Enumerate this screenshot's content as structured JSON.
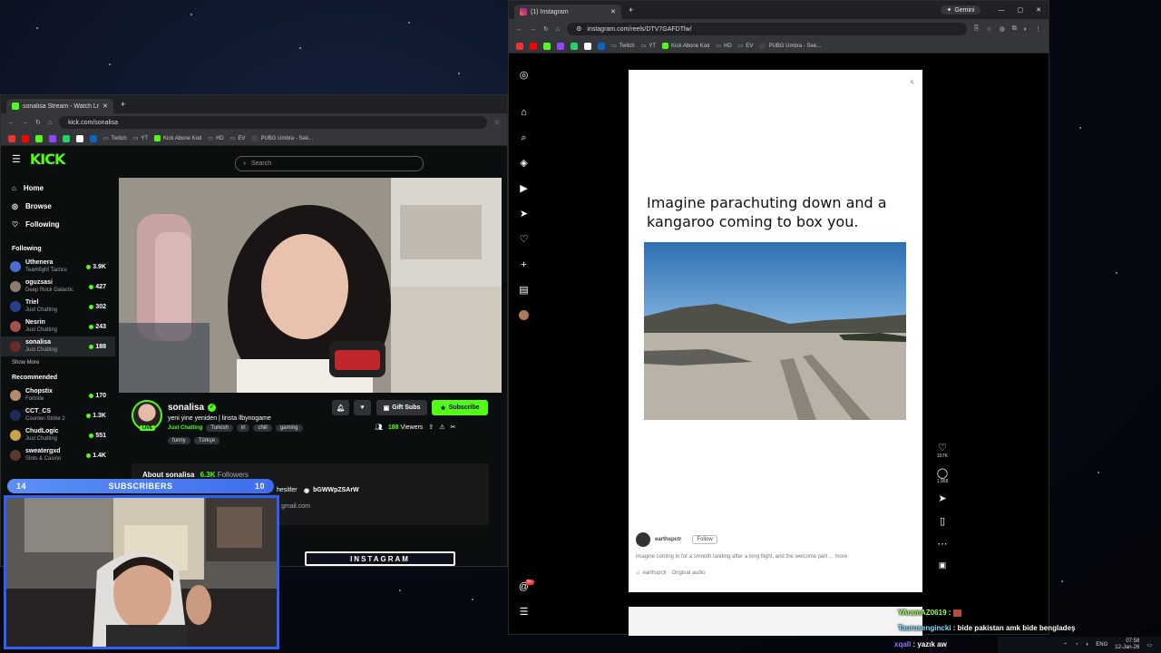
{
  "kick_browser": {
    "tab_title": "sonalisa Stream - Watch Live o",
    "url": "kick.com/sonalisa",
    "bookmarks": [
      "Twitch",
      "YT",
      "Kick Abone Kod",
      "HD",
      "EV",
      "PUBG Umbra - Seé..."
    ],
    "search_placeholder": "Search",
    "nav": [
      "Home",
      "Browse",
      "Following"
    ],
    "following_header": "Following",
    "following": [
      {
        "name": "Uthenera",
        "category": "Teamfight Tactics",
        "viewers": "3.9K"
      },
      {
        "name": "oguzsasi",
        "category": "Deep Rock Galactic",
        "viewers": "427"
      },
      {
        "name": "Triel",
        "category": "Just Chatting",
        "viewers": "302"
      },
      {
        "name": "Nesrin",
        "category": "Just Chatting",
        "viewers": "243"
      },
      {
        "name": "sonalisa",
        "category": "Just Chatting",
        "viewers": "188"
      }
    ],
    "show_more": "Show More",
    "recommended_header": "Recommended",
    "recommended": [
      {
        "name": "Chopstix",
        "category": "Fortnite",
        "viewers": "170"
      },
      {
        "name": "CCT_CS",
        "category": "Counter-Strike 2",
        "viewers": "1.3K"
      },
      {
        "name": "ChudLogic",
        "category": "Just Chatting",
        "viewers": "551"
      },
      {
        "name": "sweatergxd",
        "category": "Slots & Casino",
        "viewers": "1.4K"
      }
    ],
    "streamer": {
      "name": "sonalisa",
      "title": "yeni yine yeniden | linsta llbynogame",
      "category": "Just Chatting",
      "tags": [
        "Turkish",
        "irl",
        "chill",
        "gaming"
      ],
      "tags2": [
        "funny",
        "Türkçe"
      ],
      "live": "LIVE",
      "viewers": "188",
      "viewers_label": "Viewers",
      "gift_subs": "Gift Subs",
      "subscribe": "Subscribe"
    },
    "about": {
      "title": "About sonalisa",
      "followers": "6.3K",
      "followers_label": "Followers",
      "link1": "hesitler",
      "discord": "bGWWpZSArW",
      "email_fragment": "gmail.com"
    }
  },
  "overlay": {
    "subs_left": "14",
    "subs_label": "SUBSCRIBERS",
    "subs_right": "10",
    "banner": "INSTAGRAM"
  },
  "ig_browser": {
    "tab_title": "(1) Instagram",
    "url": "instagram.com/reels/DTV7GAFDTlw/",
    "gemini": "Gemini",
    "bookmarks": [
      "Twitch",
      "YT",
      "Kick Abone Kod",
      "HD",
      "EV",
      "PUBG Umbra - Seé..."
    ],
    "reel": {
      "caption_text": "Imagine parachuting down and a kangaroo coming to box you.",
      "username": "earthspctr",
      "follow": "Follow",
      "description": "imagine coming in for a smooth landing after a long flight, and the welcome part",
      "more": "... more",
      "audio": "earthspctr · Original audio",
      "likes": "157K",
      "comments": "1,968"
    },
    "notification_badge": "9+"
  },
  "chat": [
    {
      "user": "YAramAZ0619",
      "message": "",
      "color": "#9bff5a"
    },
    {
      "user": "Taurusengincki",
      "message": "bide pakistan amk bide bengladeş",
      "color": "#7fe0ff"
    },
    {
      "user": "xqall",
      "message": "yazık aw",
      "color": "#9b7bff"
    }
  ],
  "taskbar": {
    "lang": "ENG",
    "time": "07:58",
    "date": "12-Jan-26"
  }
}
